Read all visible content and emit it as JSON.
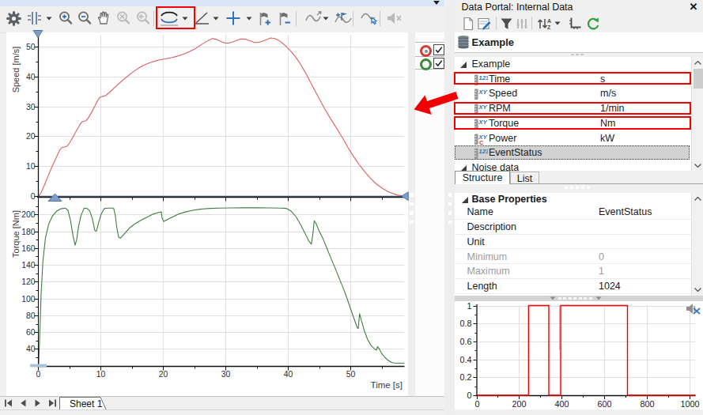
{
  "window": {
    "overflow_glyph": "toolbar-overflow"
  },
  "main_toolbar": {
    "items": [
      {
        "name": "settings-gear",
        "x": 8
      },
      {
        "name": "axis-cursor",
        "x": 34,
        "dropdown": true,
        "ddx": 24
      },
      {
        "name": "zoom-in",
        "x": 73
      },
      {
        "name": "zoom-out",
        "x": 97
      },
      {
        "name": "pan-hand",
        "x": 121
      },
      {
        "name": "zoom-off",
        "x": 146,
        "disabled": true
      },
      {
        "name": "zoom-prev",
        "x": 171,
        "disabled": true
      },
      {
        "sep": true,
        "x": 194
      },
      {
        "name": "band-cursor",
        "x": 201,
        "dropdown": true,
        "ddx": 29,
        "highlighted": true
      },
      {
        "name": "slope-cursor",
        "x": 245,
        "dropdown": true,
        "ddx": 24
      },
      {
        "name": "crosshair-cursor",
        "x": 285,
        "dropdown": true,
        "ddx": 26
      },
      {
        "name": "flag-set",
        "x": 326
      },
      {
        "name": "flag-clear",
        "x": 351
      },
      {
        "sep": true,
        "x": 374
      },
      {
        "name": "curve-transform",
        "x": 386,
        "dropdown": true,
        "ddx": 22
      },
      {
        "name": "curve-flag",
        "x": 423
      },
      {
        "sep": true,
        "x": 446
      },
      {
        "name": "curve-select-hand",
        "x": 456
      },
      {
        "sep": true,
        "x": 480
      },
      {
        "name": "audio-replay",
        "x": 488,
        "disabled": true
      }
    ],
    "highlight_color": "#f20000"
  },
  "view": {
    "x_axis_label": "Time [s]",
    "sheet_bar": {
      "tab_label": "Sheet 1",
      "nav_icons": [
        "first-sheet-icon",
        "previous-sheet-icon",
        "next-sheet-icon",
        "last-sheet-icon"
      ]
    },
    "legend": [
      {
        "name": "speed-curve",
        "ring_color": "#d43c3c",
        "filled_center": true,
        "checked": true
      },
      {
        "name": "torque-curve",
        "ring_color": "#3b8a3b",
        "filled_center": false,
        "checked": true
      }
    ]
  },
  "chart_data": [
    {
      "type": "line",
      "id": "speed",
      "title": "",
      "ylabel": "Speed [m/s]",
      "xlabel": "",
      "color": "#dc5f5f",
      "ylim": [
        0,
        53.5
      ],
      "xlim": [
        0,
        58.6
      ],
      "y_ticks": [
        0,
        10,
        20,
        30,
        40,
        50
      ],
      "x_ticks": [
        0,
        10,
        20,
        30,
        40,
        50
      ],
      "points": [
        [
          0.15,
          0
        ],
        [
          0.5,
          1.2
        ],
        [
          1,
          3.5
        ],
        [
          1.6,
          6.6
        ],
        [
          2.2,
          9.6
        ],
        [
          2.8,
          12.3
        ],
        [
          3.3,
          14.6
        ],
        [
          3.6,
          15.8
        ],
        [
          3.9,
          16.3
        ],
        [
          4.2,
          16.4
        ],
        [
          4.6,
          16.6
        ],
        [
          5,
          17.6
        ],
        [
          5.6,
          19.7
        ],
        [
          6.2,
          22
        ],
        [
          6.7,
          23.9
        ],
        [
          7,
          24.7
        ],
        [
          7.3,
          25
        ],
        [
          7.7,
          25.2
        ],
        [
          8.1,
          26.3
        ],
        [
          8.7,
          28.4
        ],
        [
          9.2,
          30.5
        ],
        [
          9.6,
          32.2
        ],
        [
          9.9,
          33
        ],
        [
          10.3,
          33.3
        ],
        [
          10.8,
          33.6
        ],
        [
          11.5,
          34.8
        ],
        [
          12.3,
          36.4
        ],
        [
          13.2,
          38.1
        ],
        [
          14.2,
          39.9
        ],
        [
          15.3,
          41.7
        ],
        [
          16.4,
          43.2
        ],
        [
          17.5,
          44.3
        ],
        [
          18.4,
          45
        ],
        [
          19.3,
          45.5
        ],
        [
          20.3,
          45.9
        ],
        [
          21.3,
          46.3
        ],
        [
          22.3,
          46.8
        ],
        [
          23.3,
          47.5
        ],
        [
          24.3,
          48.4
        ],
        [
          25.3,
          49.5
        ],
        [
          26.3,
          50.9
        ],
        [
          27.2,
          52
        ],
        [
          27.9,
          52.7
        ],
        [
          28.5,
          52.5
        ],
        [
          29.2,
          51.8
        ],
        [
          29.9,
          51.2
        ],
        [
          30.5,
          51.2
        ],
        [
          31.2,
          51.6
        ],
        [
          31.9,
          52.2
        ],
        [
          32.5,
          52.6
        ],
        [
          33.2,
          52.5
        ],
        [
          33.9,
          52
        ],
        [
          34.6,
          51.4
        ],
        [
          35.2,
          51.4
        ],
        [
          35.9,
          51.8
        ],
        [
          36.6,
          52.4
        ],
        [
          37.2,
          52.9
        ],
        [
          37.9,
          52.7
        ],
        [
          38.5,
          52.1
        ],
        [
          39.1,
          51.2
        ],
        [
          39.7,
          50.1
        ],
        [
          40.4,
          48.6
        ],
        [
          41.2,
          46.6
        ],
        [
          42,
          44.1
        ],
        [
          42.9,
          40.9
        ],
        [
          43.8,
          37.3
        ],
        [
          44.8,
          33.3
        ],
        [
          45.8,
          29.5
        ],
        [
          46.8,
          25.9
        ],
        [
          47.8,
          22.6
        ],
        [
          48.7,
          19.5
        ],
        [
          49.6,
          16.2
        ],
        [
          50.5,
          13.2
        ],
        [
          51.4,
          10.5
        ],
        [
          52.3,
          8.1
        ],
        [
          53.2,
          5.9
        ],
        [
          54.1,
          4.1
        ],
        [
          55,
          2.7
        ],
        [
          55.9,
          1.6
        ],
        [
          56.8,
          0.8
        ],
        [
          57.6,
          0.3
        ],
        [
          58.2,
          0.1
        ],
        [
          58.5,
          0
        ]
      ]
    },
    {
      "type": "line",
      "id": "torque",
      "title": "",
      "ylabel": "Torque [Nm]",
      "xlabel": "Time [s]",
      "color": "#3e7d3e",
      "ylim": [
        19.7,
        216.7
      ],
      "xlim": [
        0,
        58.6
      ],
      "y_ticks": [
        40,
        60,
        80,
        100,
        120,
        140,
        160,
        180,
        200
      ],
      "x_ticks": [
        0,
        10,
        20,
        30,
        40,
        50
      ],
      "points": [
        [
          0.1,
          20
        ],
        [
          0.3,
          60
        ],
        [
          0.5,
          105
        ],
        [
          0.8,
          145
        ],
        [
          1.2,
          172
        ],
        [
          1.7,
          188
        ],
        [
          2.3,
          198
        ],
        [
          3,
          204
        ],
        [
          3.7,
          206.8
        ],
        [
          4.4,
          207.5
        ],
        [
          4.8,
          205
        ],
        [
          5.2,
          193
        ],
        [
          5.6,
          175
        ],
        [
          5.95,
          163.5
        ],
        [
          6.2,
          170
        ],
        [
          6.5,
          186
        ],
        [
          6.9,
          199
        ],
        [
          7.4,
          207.5
        ],
        [
          7.9,
          207
        ],
        [
          8.3,
          204
        ],
        [
          8.7,
          195
        ],
        [
          9.1,
          181
        ],
        [
          9.35,
          180
        ],
        [
          9.7,
          190
        ],
        [
          10.1,
          200
        ],
        [
          10.6,
          207
        ],
        [
          11.2,
          207.5
        ],
        [
          12.1,
          207.5
        ],
        [
          12.35,
          200
        ],
        [
          12.6,
          185
        ],
        [
          12.9,
          173
        ],
        [
          13.2,
          171.8
        ],
        [
          13.8,
          177
        ],
        [
          14.6,
          183.5
        ],
        [
          15.5,
          188.8
        ],
        [
          16.4,
          192.8
        ],
        [
          17.4,
          196.6
        ],
        [
          18.3,
          200
        ],
        [
          19.2,
          202.2
        ],
        [
          19.75,
          203
        ],
        [
          19.85,
          196
        ],
        [
          20.1,
          191.5
        ],
        [
          20.6,
          193.5
        ],
        [
          21.5,
          197
        ],
        [
          22.5,
          200.5
        ],
        [
          23.6,
          203
        ],
        [
          24.8,
          205
        ],
        [
          26,
          206.3
        ],
        [
          27.5,
          207.2
        ],
        [
          29,
          207.6
        ],
        [
          31,
          207.8
        ],
        [
          33,
          207.9
        ],
        [
          35,
          207.9
        ],
        [
          37,
          207.8
        ],
        [
          38.8,
          207.6
        ],
        [
          39.7,
          207.2
        ],
        [
          40.5,
          204
        ],
        [
          41.3,
          197
        ],
        [
          42,
          188
        ],
        [
          42.7,
          178
        ],
        [
          43.3,
          169
        ],
        [
          43.75,
          164.5
        ],
        [
          44,
          178
        ],
        [
          44.2,
          192.5
        ],
        [
          44.5,
          189
        ],
        [
          45,
          180
        ],
        [
          45.6,
          171
        ],
        [
          46.2,
          160
        ],
        [
          46.9,
          147.5
        ],
        [
          47.6,
          135
        ],
        [
          48.2,
          124
        ],
        [
          48.9,
          111
        ],
        [
          49.5,
          99
        ],
        [
          50.1,
          86
        ],
        [
          50.7,
          73
        ],
        [
          51.1,
          65
        ],
        [
          51.25,
          64.5
        ],
        [
          51.45,
          82
        ],
        [
          51.7,
          75
        ],
        [
          52.2,
          62
        ],
        [
          52.7,
          52
        ],
        [
          53.3,
          44
        ],
        [
          53.9,
          39.5
        ],
        [
          54.15,
          38.8
        ],
        [
          54.35,
          42.7
        ],
        [
          54.6,
          40
        ],
        [
          55,
          34.5
        ],
        [
          55.5,
          30
        ],
        [
          56,
          26.5
        ],
        [
          56.5,
          24.2
        ],
        [
          57,
          23.2
        ],
        [
          57.6,
          23
        ],
        [
          58.4,
          23
        ],
        [
          58.6,
          23
        ]
      ]
    },
    {
      "type": "line",
      "id": "eventstatus-preview",
      "title": "",
      "ylabel": "",
      "xlabel": "",
      "color": "#ee0000",
      "ylim": [
        0,
        1
      ],
      "xlim": [
        0,
        1030
      ],
      "y_ticks": [
        0,
        0.2,
        0.4,
        0.6,
        0.8,
        1
      ],
      "x_ticks": [
        0,
        200,
        400,
        600,
        800,
        1000
      ],
      "marker_x": 390,
      "points": [
        [
          0,
          0
        ],
        [
          245,
          0
        ],
        [
          245,
          1
        ],
        [
          340,
          1
        ],
        [
          340,
          0
        ],
        [
          396,
          0
        ],
        [
          396,
          1
        ],
        [
          710,
          1
        ],
        [
          710,
          0
        ],
        [
          1030,
          0
        ]
      ]
    }
  ],
  "data_portal": {
    "title": "Data Portal: Internal Data",
    "close_glyph": "✕",
    "toolbar": {
      "items": [
        {
          "name": "new-document",
          "x": 9
        },
        {
          "name": "edit-register",
          "x": 28
        },
        {
          "sep": true,
          "x": 52
        },
        {
          "name": "filter-funnel",
          "x": 57
        },
        {
          "name": "equalizer",
          "x": 76,
          "disabled": true
        },
        {
          "sep": true,
          "x": 97
        },
        {
          "name": "sort-az",
          "x": 103,
          "dropdown": true
        },
        {
          "name": "axis-scale",
          "x": 144
        },
        {
          "name": "refresh",
          "x": 166
        }
      ]
    },
    "root_label": "Example",
    "tree": [
      {
        "kind": "group",
        "label": "Example"
      },
      {
        "kind": "channel",
        "icon": "123",
        "label": "Time",
        "unit": "s",
        "boxed": true
      },
      {
        "kind": "channel",
        "icon": "XY",
        "label": "Speed",
        "unit": "m/s"
      },
      {
        "kind": "channel",
        "icon": "XY",
        "label": "RPM",
        "unit": "1/min",
        "boxed": true
      },
      {
        "kind": "channel",
        "icon": "XY",
        "label": "Torque",
        "unit": "Nm",
        "boxed": true
      },
      {
        "kind": "channel",
        "icon": "XYC",
        "label": "Power",
        "unit": "kW"
      },
      {
        "kind": "channel",
        "icon": "123",
        "label": "EventStatus",
        "unit": "",
        "selected": true
      },
      {
        "kind": "group",
        "label": "Noise data",
        "clipped": true
      }
    ],
    "tabs": [
      {
        "label": "Structure",
        "active": true
      },
      {
        "label": "List",
        "active": false
      }
    ],
    "properties": {
      "title": "Base Properties",
      "rows": [
        {
          "label": "Name",
          "value": "EventStatus"
        },
        {
          "label": "Description",
          "value": ""
        },
        {
          "label": "Unit",
          "value": ""
        },
        {
          "label": "Minimum",
          "value": "0",
          "muted": true
        },
        {
          "label": "Maximum",
          "value": "1",
          "muted": true
        },
        {
          "label": "Length",
          "value": "1024"
        }
      ]
    }
  },
  "annotations": {
    "color": "#f20000",
    "boxes": [
      "toolbar-band-cursor",
      "tree-row-time",
      "tree-row-rpm",
      "tree-row-torque"
    ],
    "arrow": {
      "from": "tree-row-rpm",
      "to": "speed-chart"
    }
  }
}
